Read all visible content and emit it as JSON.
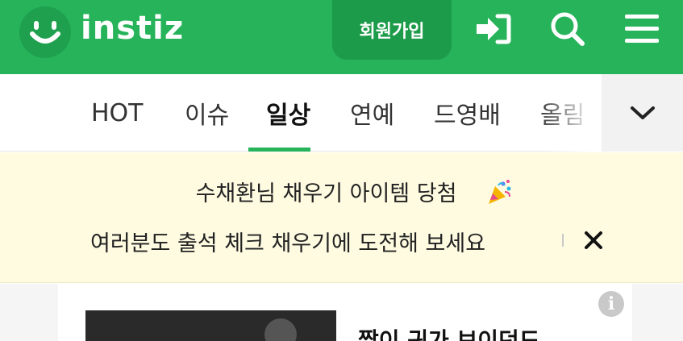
{
  "header": {
    "logo_text": "instiz",
    "signup_label": "회원가입",
    "icons": [
      "smile-logo-icon",
      "login-icon",
      "search-icon",
      "menu-icon"
    ],
    "colors": {
      "brand": "#26b35a",
      "brand_dark": "#1c9b4a"
    }
  },
  "tabs": {
    "items": [
      {
        "label": "HOT",
        "active": false
      },
      {
        "label": "이슈",
        "active": false
      },
      {
        "label": "일상",
        "active": true
      },
      {
        "label": "연예",
        "active": false
      },
      {
        "label": "드영배",
        "active": false
      },
      {
        "label": "올림",
        "active": false
      }
    ],
    "more_icon": "chevron-down-icon"
  },
  "notice": {
    "line1": "수채환님 채우기 아이템 당첨",
    "line2": "여러분도 출석 체크 채우기에 도전해 보세요",
    "emoji_icon": "party-popper-icon",
    "close_icon": "close-icon",
    "background": "#fefbe1"
  },
  "card": {
    "title": "짤이 귀가 보이던도",
    "info_icon": "info-icon",
    "info_label": "i"
  }
}
